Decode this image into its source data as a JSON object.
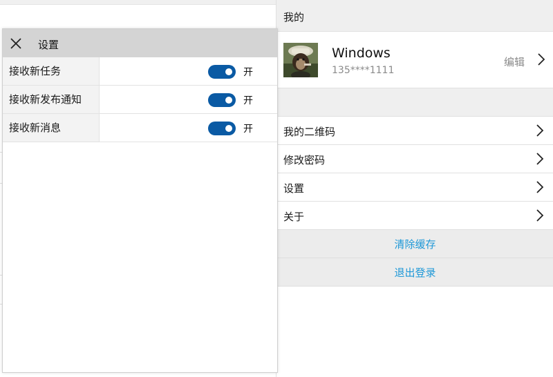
{
  "right_panel": {
    "header_title": "我的",
    "profile": {
      "name": "Windows",
      "phone": "135****1111",
      "edit_label": "编辑",
      "avatar_icon": "monkey-avatar"
    },
    "menu_items": [
      {
        "label": "我的二维码"
      },
      {
        "label": "修改密码"
      },
      {
        "label": "设置"
      },
      {
        "label": "关于"
      }
    ],
    "actions": {
      "clear_cache": "清除缓存",
      "logout": "退出登录"
    }
  },
  "settings_dialog": {
    "title": "设置",
    "rows": [
      {
        "label": "接收新任务",
        "state": "开",
        "on": true
      },
      {
        "label": "接收新发布通知",
        "state": "开",
        "on": true
      },
      {
        "label": "接收新消息",
        "state": "开",
        "on": true
      }
    ]
  },
  "colors": {
    "accent_blue": "#1e98d7",
    "toggle_on": "#0a5aa4",
    "header_gray": "#d4d4d4"
  }
}
